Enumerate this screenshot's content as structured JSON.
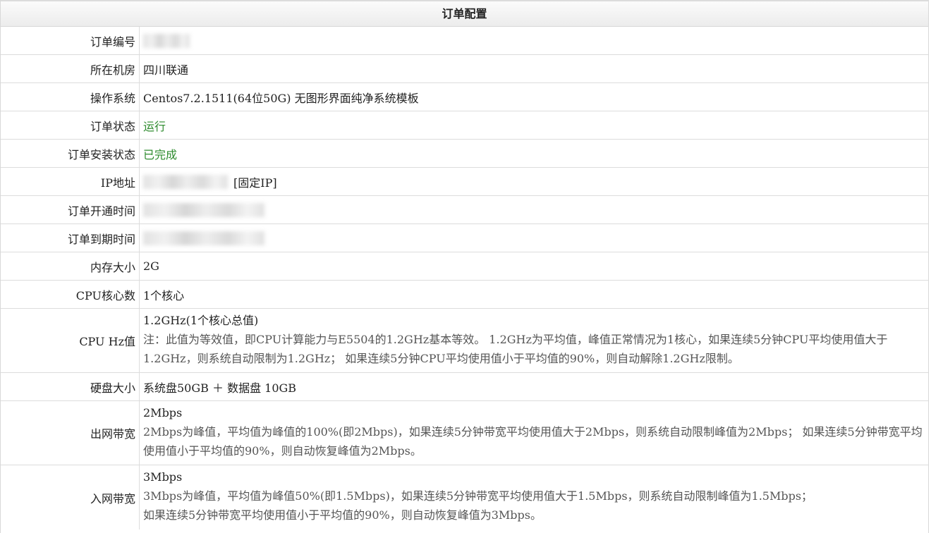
{
  "header": {
    "title": "订单配置"
  },
  "rows": {
    "order_no": {
      "label": "订单编号"
    },
    "room": {
      "label": "所在机房",
      "value": "四川联通"
    },
    "os": {
      "label": "操作系统",
      "value": "Centos7.2.1511(64位50G) 无图形界面纯净系统模板"
    },
    "status": {
      "label": "订单状态",
      "value": "运行"
    },
    "install_status": {
      "label": "订单安装状态",
      "value": "已完成"
    },
    "ip": {
      "label": "IP地址",
      "tag": "[固定IP]"
    },
    "open_time": {
      "label": "订单开通时间"
    },
    "expire_time": {
      "label": "订单到期时间"
    },
    "memory": {
      "label": "内存大小",
      "value": "2G"
    },
    "cpu_cores": {
      "label": "CPU核心数",
      "value": "1个核心"
    },
    "cpu_hz": {
      "label": "CPU Hz值",
      "value": "1.2GHz(1个核心总值)",
      "note": "注：此值为等效值，即CPU计算能力与E5504的1.2GHz基本等效。 1.2GHz为平均值，峰值正常情况为1核心，如果连续5分钟CPU平均使用值大于1.2GHz，则系统自动限制为1.2GHz； 如果连续5分钟CPU平均使用值小于平均值的90%，则自动解除1.2GHz限制。"
    },
    "disk": {
      "label": "硬盘大小",
      "value": "系统盘50GB ＋ 数据盘 10GB"
    },
    "bw_out": {
      "label": "出网带宽",
      "value": "2Mbps",
      "note": "2Mbps为峰值，平均值为峰值的100%(即2Mbps)，如果连续5分钟带宽平均使用值大于2Mbps，则系统自动限制峰值为2Mbps； 如果连续5分钟带宽平均使用值小于平均值的90%，则自动恢复峰值为2Mbps。"
    },
    "bw_in": {
      "label": "入网带宽",
      "value": "3Mbps",
      "note1": "3Mbps为峰值，平均值为峰值50%(即1.5Mbps)，如果连续5分钟带宽平均使用值大于1.5Mbps，则系统自动限制峰值为1.5Mbps；",
      "note2": "如果连续5分钟带宽平均使用值小于平均值的90%，则自动恢复峰值为3Mbps。"
    }
  },
  "colors": {
    "status_green": "#2e8b2e",
    "border": "#dcdcdc",
    "note_text": "#555555"
  }
}
